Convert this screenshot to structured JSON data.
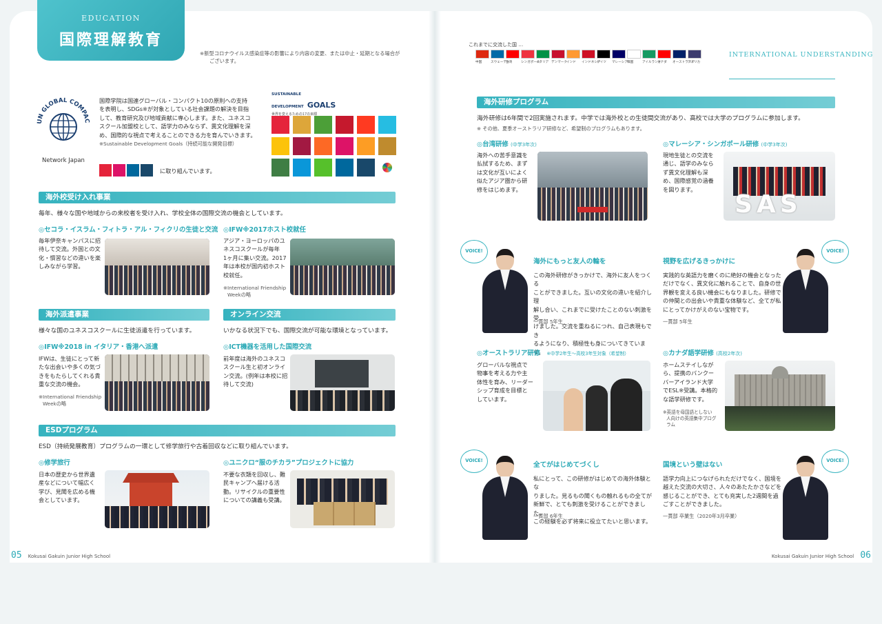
{
  "header": {
    "tag": "EDUCATION",
    "title": "国際理解教育",
    "note_l1": "※新型コロナウイルス感染症等の影響により内容の変更、または中止・延期となる場合が",
    "note_l2": "ございます。",
    "right_title": "INTERNATIONAL UNDERSTANDING"
  },
  "un_logo": {
    "ring_text": "UN GLOBAL COMPACT",
    "sub": "Network Japan"
  },
  "intro": {
    "lines": [
      "国際学院は国連グローバル・コンパクト10の原則への支持",
      "を表明し、SDGs※が対象としている社会課題の解決を目指",
      "して、教育研究及び地域貢献に専心します。また、ユネスコ",
      "スクール加盟校として、語学力のみならず、異文化理解を深",
      "め、国際的な視点で考えることのできる力を育んでいきます。"
    ],
    "note": "※Sustainable Development Goals（持続可能な開発目標）",
    "tail": "に取り組んでいます。"
  },
  "sdgs": {
    "logo_l1": "SUSTAINABLE",
    "logo_l2": "DEVELOPMENT",
    "logo_goals": "GOALS",
    "logo_sub": "世界を変えるための17の目標"
  },
  "sec_accept": {
    "title": "海外校受け入れ事業",
    "lead": "毎年、様々な国や地域からの来校者を受け入れ、学校全体の国際交流の機会としています。",
    "item1": {
      "title": "セコラ・イスラム・フィトラ・アル・フィクリの生徒と交流",
      "lines": [
        "毎年伊奈キャンパスに招",
        "待して交流。外国との文",
        "化・慣習などの違いを楽",
        "しみながら学習。"
      ]
    },
    "item2": {
      "title": "IFW※2017ホスト校就任",
      "lines": [
        "アジア・ヨーロッパのユ",
        "ネスコスクールが毎年",
        "1ヶ月に集い交流。2017",
        "年は本校が国内初ホスト",
        "校就任。"
      ],
      "note_l1": "※International Friendship",
      "note_l2": "Weekの略"
    }
  },
  "sec_dispatch": {
    "title": "海外派遣事業",
    "lead": "様々な国のユネスコスクールに生徒派遣を行っています。",
    "item": {
      "title": "IFW※2018 in イタリア・香港へ派遣",
      "lines": [
        "IFWは、生徒にとって新",
        "たな出会いや多くの気づ",
        "きをもたらしてくれる貴",
        "重な交流の機会。"
      ],
      "note_l1": "※International Friendship",
      "note_l2": "Weekの略"
    }
  },
  "sec_online": {
    "title": "オンライン交流",
    "lead": "いかなる状況下でも、国際交流が可能な環境となっています。",
    "item": {
      "title": "ICT機器を活用した国際交流",
      "lines": [
        "前年度は海外のユネスコ",
        "スクール生と初オンライ",
        "ン交流。(例年は本校に招",
        "待して交流)"
      ]
    }
  },
  "sec_esd": {
    "title": "ESDプログラム",
    "lead": "ESD（持続発展教育）プログラムの一環として修学旅行や古着回収などに取り組んでいます。",
    "item1": {
      "title": "修学旅行",
      "lines": [
        "日本の歴史から世界遺",
        "産などについて幅広く",
        "学び、見聞を広める機",
        "会としています。"
      ]
    },
    "item2": {
      "title": "ユニクロ“服のチカラ”プロジェクトに協力",
      "lines": [
        "不要な衣類を回収し、難",
        "民キャンプへ届ける活",
        "動。リサイクルの重要性",
        "についての講義も受講。"
      ]
    }
  },
  "flags": {
    "heading": "これまでに交流した国 …",
    "labels": [
      "中国",
      "スウェーデン",
      "台湾",
      "シンガポール",
      "イタリア",
      "デンマーク",
      "インド",
      "インドネシア",
      "ドイツ",
      "マレーシア",
      "韓国",
      "アイルランド",
      "カナダ",
      "オーストラリア",
      "アメリカ"
    ],
    "colors": [
      "#de2910",
      "#006aa7",
      "#fe0000",
      "#ef3340",
      "#009246",
      "#c8102e",
      "#ff9933",
      "#ce1126",
      "#000000",
      "#010066",
      "#ffffff",
      "#169b62",
      "#ff0000",
      "#012169",
      "#3c3b6e"
    ]
  },
  "sec_abroad": {
    "title": "海外研修プログラム",
    "lead": "海外研修は6年間で2回実施されます。中学では海外校との生徒間交流があり、高校では大学のプログラムに参加します。",
    "note": "※ その他、夏季オーストラリア研修など、希望制のプログラムもあります。",
    "taiwan": {
      "title": "台湾研修",
      "tag": "(中学3年次)",
      "lines": [
        "海外への苦手意識を",
        "払拭するため、まず",
        "は文化が互いによく",
        "似たアジア圏から研",
        "修をはじめます。"
      ]
    },
    "malaysia": {
      "title": "マレーシア・シンガポール研修",
      "tag": "(中学3年次)",
      "lines": [
        "現地生徒との交流を",
        "通じ、語学のみなら",
        "ず異文化理解も深",
        "め、国際感覚の涵養",
        "を図ります。"
      ],
      "photo_text": "SAS"
    },
    "australia": {
      "title": "オーストラリア研修",
      "tag": "※中学2年生～高校3年生対象（希望制）",
      "lines": [
        "グローバルな視点で",
        "物事を考える力や主",
        "体性を育み、リーダー",
        "シップ育成を目標と",
        "しています。"
      ]
    },
    "canada": {
      "title": "カナダ語学研修",
      "tag": "(高校2年次)",
      "lines": [
        "ホームステイしなが",
        "ら、提携のバンクー",
        "バーアイランド大学",
        "でESL※受講。本格的",
        "な語学研修です。"
      ],
      "note": [
        "※英語を母国語としない",
        "人向けの英語集中プログ",
        "ラム"
      ]
    }
  },
  "voices": {
    "badge": "VOICE!",
    "v1": {
      "title": "海外にもっと友人の輪を",
      "lines": [
        "この海外研修がきっかけで、海外に友人をつくる",
        "ことができました。互いの文化の違いを紹介し理",
        "解し合い、これまでに受けたことのない刺激を受",
        "けました。交流を重ねるにつれ、自己表現もでき",
        "るようになり、積極性も身についてきています。"
      ],
      "author": "一貫部 5年生"
    },
    "v2": {
      "title": "視野を広げるきっかけに",
      "lines": [
        "実践的な英語力を磨くのに絶好の機会となった",
        "だけでなく、異文化に触れることで、自身の世",
        "界観を変える良い機会にもなりました。研修で",
        "の仲間との出会いや貴重な体験など、全てが私",
        "にとってかけがえのない宝物です。"
      ],
      "author": "一貫部 5年生"
    },
    "v3": {
      "title": "全てがはじめてづくし",
      "lines": [
        "私にとって、この研修がはじめての海外体験とな",
        "りました。見るもの聞くもの触れるもの全てが",
        "新鮮で、とても刺激を受けることができました。",
        "この経験を必ず将来に役立てたいと思います。"
      ],
      "author": "一貫部 6年生"
    },
    "v4": {
      "title": "国境という壁はない",
      "lines": [
        "語学力向上につなげられただけでなく、国境を",
        "越えた交流の大切さ、人々のあたたかさなどを",
        "感じることができ、とても充実した2週間を過",
        "ごすことができました。"
      ],
      "author": "一貫部 卒業生（2020年3月卒業）"
    }
  },
  "footer": {
    "left_num": "05",
    "left_school": "Kokusai Gakuin Junior High School",
    "right_school": "Kokusai Gakuin Junior High School",
    "right_num": "06"
  }
}
